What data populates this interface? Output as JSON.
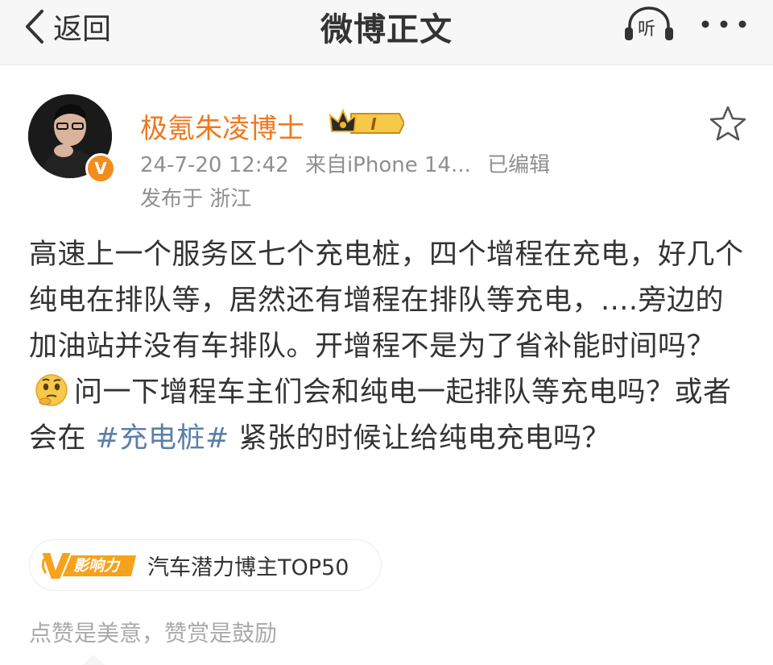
{
  "nav": {
    "back_label": "返回",
    "title": "微博正文",
    "listen_label": "听"
  },
  "author": {
    "name": "极氪朱凌博士",
    "verified_mark": "V",
    "vip_level": "I"
  },
  "meta": {
    "time": "24-7-20 12:42",
    "source": "来自iPhone 14...",
    "edited": "已编辑",
    "location": "发布于 浙江"
  },
  "post": {
    "text_part1": "高速上一个服务区七个充电桩，四个增程在充电，好几个纯电在排队等，居然还有增程在排队等充电，....旁边的加油站并没有车排队。开增程不是为了省补能时间吗？",
    "emoji": "thinking-face",
    "text_part2": "问一下增程车主们会和纯电一起排队等充电吗？或者会在",
    "hashtag": "#充电桩#",
    "text_part3": "紧张的时候让给纯电充电吗？"
  },
  "influence": {
    "logo_text": "影响力",
    "rank": "汽车潜力博主TOP50"
  },
  "footer": {
    "slogan": "点赞是美意，赞赏是鼓励"
  },
  "colors": {
    "username": "#f0781e",
    "hashtag": "#5a7fa8",
    "meta": "#8f8f8f",
    "badge": "#f28c1c"
  }
}
